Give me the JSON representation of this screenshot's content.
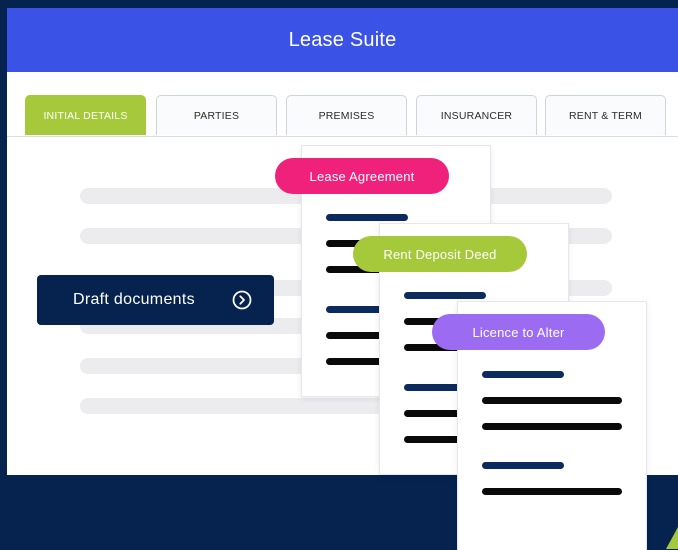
{
  "app": {
    "title": "Lease Suite"
  },
  "tabs": [
    {
      "label": "INITIAL DETAILS",
      "active": true
    },
    {
      "label": "PARTIES",
      "active": false
    },
    {
      "label": "PREMISES",
      "active": false
    },
    {
      "label": "INSURANCER",
      "active": false
    },
    {
      "label": "RENT & TERM",
      "active": false
    }
  ],
  "draft_button": {
    "label": "Draft documents",
    "icon": "chevron-right-circle-icon"
  },
  "documents": [
    {
      "label": "Lease Agreement",
      "color": "#f0217a"
    },
    {
      "label": "Rent Deposit Deed",
      "color": "#a6c83b"
    },
    {
      "label": "Licence to Alter",
      "color": "#9b6cf2"
    }
  ],
  "colors": {
    "background": "#06224f",
    "header": "#3a53e6",
    "active_tab": "#a6c83b",
    "navy_line": "#0b2a5e",
    "accent": "#a6c83b"
  }
}
